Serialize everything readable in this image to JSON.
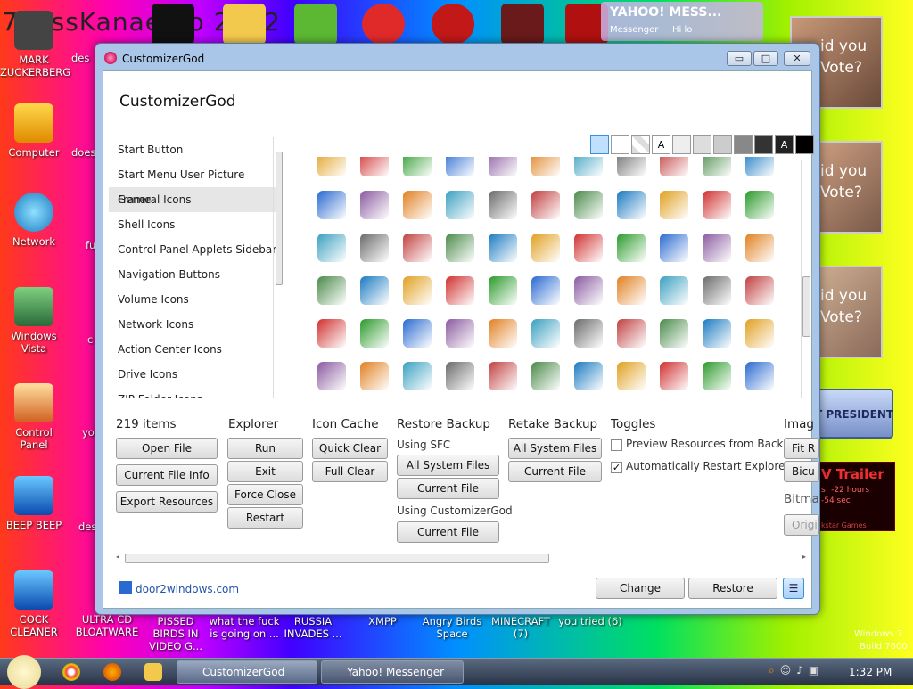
{
  "desktop": {
    "banner_text": "7 lossKanae tio 2012",
    "icons": [
      {
        "label": "MARK ZUCKERBERG",
        "name": "mark-zuckerberg-icon",
        "color": "#333"
      },
      {
        "label": "Computer",
        "name": "computer-icon",
        "color": "#e0a000"
      },
      {
        "label": "Network",
        "name": "network-icon",
        "color": "#2aa0e0"
      },
      {
        "label": "Windows Vista",
        "name": "recycle-bin-icon",
        "color": "#2a8a4a"
      },
      {
        "label": "Control Panel",
        "name": "control-panel-icon",
        "color": "#d06020"
      },
      {
        "label": "BEEP BEEP",
        "name": "beep-beep-icon",
        "color": "#1a6ad0"
      },
      {
        "label": "COCK CLEANER",
        "name": "cleaner-icon",
        "color": "#1a6ad0"
      }
    ],
    "second_col": [
      "des",
      "does",
      "fu",
      "c",
      "yo",
      "des",
      "ULTRA CD BLOATWARE"
    ],
    "bottom_labels": [
      "PISSED BIRDS IN VIDEO G...",
      "what the fuck is going on ...",
      "RUSSIA INVADES ...",
      "XMPP",
      "Angry Birds Space",
      "MINECRAFT (7)",
      "you tried (6)"
    ],
    "yahoo_widget": {
      "title": "YAHOO! MESS...",
      "line1": "Messenger",
      "line2": "Hi lo"
    },
    "posters": [
      "id you Vote?",
      "id you Vote?",
      "id you Vote?"
    ],
    "president_label": "T PRESIDENT",
    "trailer": {
      "title": "V Trailer",
      "line1": "s! -22 hours",
      "line2": "-54 sec",
      "line3": "kstar Games"
    },
    "watermark": {
      "line1": "Windows 7",
      "line2": "Build 7600"
    }
  },
  "window": {
    "title": "CustomizerGod",
    "header": "CustomizerGod",
    "controls": {
      "minimize": "▭",
      "maximize": "□",
      "close": "✕"
    },
    "categories": [
      "Start Button",
      "Start Menu User Picture Frame",
      "General Icons",
      "Shell Icons",
      "Control Panel Applets Sidebar",
      "Navigation Buttons",
      "Volume Icons",
      "Network Icons",
      "Action Center Icons",
      "Drive Icons",
      "ZIP Folder Icons"
    ],
    "selected_category": "General Icons",
    "palette": [
      "",
      "",
      "",
      "A",
      "",
      "",
      "",
      "",
      "",
      "A",
      ""
    ],
    "palette_colors": [
      "#bfe0ff",
      "#ffffff",
      "#e8e8e8",
      "#ffffff",
      "#eeeeee",
      "#dddddd",
      "#cccccc",
      "#888888",
      "#333333",
      "#222222",
      "#000000"
    ],
    "sections": {
      "items": {
        "count": "219 items",
        "open": "Open File",
        "info": "Current File Info",
        "export": "Export Resources"
      },
      "explorer": {
        "title": "Explorer",
        "run": "Run",
        "exit": "Exit",
        "force": "Force Close",
        "restart": "Restart"
      },
      "cache": {
        "title": "Icon Cache",
        "quick": "Quick Clear",
        "full": "Full Clear"
      },
      "backup": {
        "title": "Restore Backup",
        "sfc": "Using SFC",
        "all": "All System Files",
        "current": "Current File",
        "cg": "Using CustomizerGod",
        "cg_current": "Current File"
      },
      "retake": {
        "title": "Retake Backup",
        "all": "All System Files",
        "current": "Current File"
      },
      "toggles": {
        "title": "Toggles",
        "preview": "Preview Resources from Backup",
        "auto": "Automatically Restart Explorer"
      },
      "image": {
        "title": "Imag",
        "fit": "Fit R",
        "bicu": "Bicu",
        "bitmap": "Bitma",
        "orig": "Origi"
      }
    },
    "footer": {
      "link": "door2windows.com",
      "change": "Change",
      "restore": "Restore",
      "menu": "☰"
    }
  },
  "taskbar": {
    "items": [
      "CustomizerGod",
      "Yahoo! Messenger"
    ],
    "clock": "1:32 PM"
  }
}
